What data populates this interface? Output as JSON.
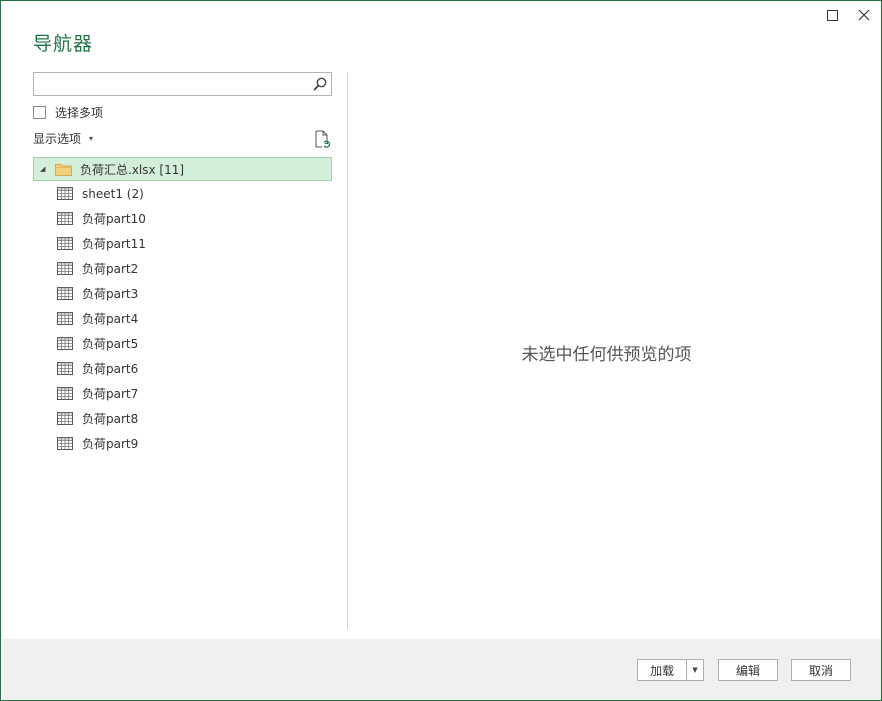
{
  "window": {
    "title": "导航器",
    "maximize_icon": "maximize-icon",
    "close_icon": "close-icon",
    "accent_color": "#217346"
  },
  "search": {
    "value": "",
    "placeholder": ""
  },
  "multi_select": {
    "label": "选择多项",
    "checked": false
  },
  "display_options": {
    "label": "显示选项",
    "caret": "▾"
  },
  "tree": {
    "root": {
      "label": "负荷汇总.xlsx [11]",
      "expanded": true,
      "selected": true,
      "arrow": "◢",
      "icon": "folder-icon"
    },
    "items": [
      {
        "label": "sheet1 (2)",
        "icon": "table-icon"
      },
      {
        "label": "负荷part10",
        "icon": "table-icon"
      },
      {
        "label": "负荷part11",
        "icon": "table-icon"
      },
      {
        "label": "负荷part2",
        "icon": "table-icon"
      },
      {
        "label": "负荷part3",
        "icon": "table-icon"
      },
      {
        "label": "负荷part4",
        "icon": "table-icon"
      },
      {
        "label": "负荷part5",
        "icon": "table-icon"
      },
      {
        "label": "负荷part6",
        "icon": "table-icon"
      },
      {
        "label": "负荷part7",
        "icon": "table-icon"
      },
      {
        "label": "负荷part8",
        "icon": "table-icon"
      },
      {
        "label": "负荷part9",
        "icon": "table-icon"
      }
    ]
  },
  "preview": {
    "message": "未选中任何供预览的项"
  },
  "footer": {
    "load_label": "加载",
    "load_dropdown": "▼",
    "edit_label": "编辑",
    "cancel_label": "取消"
  }
}
